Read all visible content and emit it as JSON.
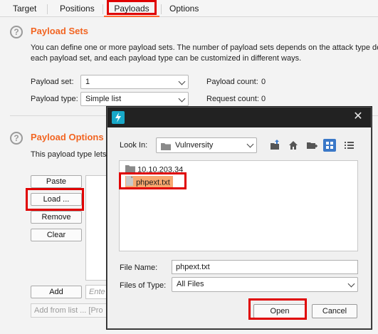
{
  "tabs": {
    "target": "Target",
    "positions": "Positions",
    "payloads": "Payloads",
    "options": "Options"
  },
  "payload_sets": {
    "title": "Payload Sets",
    "description_line1": "You can define one or more payload sets. The number of payload sets depends on the attack type defin",
    "description_line2": "each payload set, and each payload type can be customized in different ways.",
    "set_label": "Payload set:",
    "set_value": "1",
    "type_label": "Payload type:",
    "type_value": "Simple list",
    "count_label": "Payload count:",
    "count_value": "0",
    "request_label": "Request count:",
    "request_value": "0"
  },
  "payload_options": {
    "title": "Payload Options [S",
    "description": "This payload type lets y",
    "buttons": {
      "paste": "Paste",
      "load": "Load ...",
      "remove": "Remove",
      "clear": "Clear",
      "add": "Add"
    },
    "enter_placeholder": "Ente",
    "add_from_list": "Add from list ... [Pro"
  },
  "dialog": {
    "look_in_label": "Look In:",
    "look_in_value": "Vulnversity",
    "files": [
      {
        "name": "10.10.203.34",
        "kind": "folder"
      },
      {
        "name": "phpext.txt",
        "kind": "file"
      }
    ],
    "file_name_label": "File Name:",
    "file_name_value": "phpext.txt",
    "files_of_type_label": "Files of Type:",
    "files_of_type_value": "All Files",
    "open_label": "Open",
    "cancel_label": "Cancel",
    "close_glyph": "✕"
  },
  "colors": {
    "accent_orange": "#f26522",
    "highlight_red": "#e00000",
    "selection": "#f7a870",
    "titlebar": "#222222",
    "app_icon": "#18a8c8"
  }
}
